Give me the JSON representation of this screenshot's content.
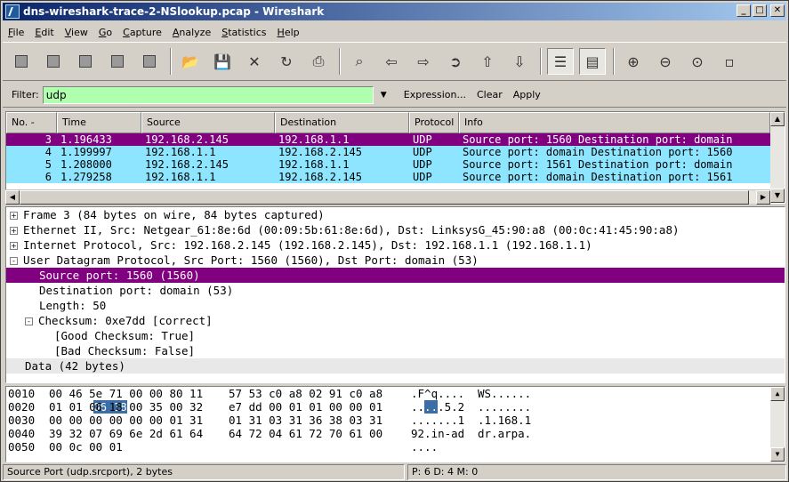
{
  "window": {
    "title": "dns-wireshark-trace-2-NSlookup.pcap - Wireshark"
  },
  "menu": [
    "File",
    "Edit",
    "View",
    "Go",
    "Capture",
    "Analyze",
    "Statistics",
    "Help"
  ],
  "toolbar": {
    "icons": [
      "interface-list-icon",
      "capture-options-icon",
      "start-capture-icon",
      "stop-capture-icon",
      "restart-capture-icon",
      "open-file-icon",
      "save-file-icon",
      "close-file-icon",
      "reload-icon",
      "print-icon",
      "find-packet-icon",
      "go-back-icon",
      "go-forward-icon",
      "go-to-packet-icon",
      "go-first-icon",
      "go-last-icon",
      "colorize-icon",
      "autoscroll-icon",
      "zoom-in-icon",
      "zoom-out-icon",
      "zoom-normal-icon",
      "resize-columns-icon"
    ]
  },
  "filter": {
    "label": "Filter:",
    "value": "udp",
    "expression": "Expression...",
    "clear": "Clear",
    "apply": "Apply"
  },
  "packet_list": {
    "columns": [
      "No. -",
      "Time",
      "Source",
      "Destination",
      "Protocol",
      "Info"
    ],
    "rows": [
      {
        "no": "3",
        "time": "1.196433",
        "src": "192.168.2.145",
        "dst": "192.168.1.1",
        "proto": "UDP",
        "info": "Source port: 1560  Destination port: domain"
      },
      {
        "no": "4",
        "time": "1.199997",
        "src": "192.168.1.1",
        "dst": "192.168.2.145",
        "proto": "UDP",
        "info": "Source port: domain  Destination port: 1560"
      },
      {
        "no": "5",
        "time": "1.208000",
        "src": "192.168.2.145",
        "dst": "192.168.1.1",
        "proto": "UDP",
        "info": "Source port: 1561  Destination port: domain"
      },
      {
        "no": "6",
        "time": "1.279258",
        "src": "192.168.1.1",
        "dst": "192.168.2.145",
        "proto": "UDP",
        "info": "Source port: domain  Destination port: 1561"
      }
    ]
  },
  "detail_tree": [
    {
      "text": "Frame 3 (84 bytes on wire, 84 bytes captured)",
      "exp": "+"
    },
    {
      "text": "Ethernet II, Src: Netgear_61:8e:6d (00:09:5b:61:8e:6d), Dst: LinksysG_45:90:a8 (00:0c:41:45:90:a8)",
      "exp": "+"
    },
    {
      "text": "Internet Protocol, Src: 192.168.2.145 (192.168.2.145), Dst: 192.168.1.1 (192.168.1.1)",
      "exp": "+"
    },
    {
      "text": "User Datagram Protocol, Src Port: 1560 (1560), Dst Port: domain (53)",
      "exp": "-"
    },
    {
      "text": "Source port: 1560 (1560)",
      "exp": ""
    },
    {
      "text": "Destination port: domain (53)",
      "exp": ""
    },
    {
      "text": "Length: 50",
      "exp": ""
    },
    {
      "text": "Checksum: 0xe7dd [correct]",
      "exp": "-"
    },
    {
      "text": "[Good Checksum: True]",
      "exp": ""
    },
    {
      "text": "[Bad Checksum: False]",
      "exp": ""
    },
    {
      "text": "Data (42 bytes)",
      "exp": ""
    }
  ],
  "hex_dump": [
    {
      "off": "0010",
      "hex1": "00 46 5e 71 00 00 80 11",
      "hex2": "57 53 c0 a8 02 91 c0 a8",
      "ascii1": ".F^q....",
      "ascii2": "WS......"
    },
    {
      "off": "0020",
      "hex1": "01 01 06 18 00 35 00 32",
      "hex2": "e7 dd 00 01 01 00 00 01",
      "ascii1": ".....5.2",
      "ascii2": "........"
    },
    {
      "off": "0030",
      "hex1": "00 00 00 00 00 00 01 31",
      "hex2": "01 31 03 31 36 38 03 31",
      "ascii1": ".......1",
      "ascii2": ".1.168.1"
    },
    {
      "off": "0040",
      "hex1": "39 32 07 69 6e 2d 61 64",
      "hex2": "64 72 04 61 72 70 61 00",
      "ascii1": "92.in-ad",
      "ascii2": "dr.arpa."
    },
    {
      "off": "0050",
      "hex1": "00 0c 00 01",
      "hex2": "",
      "ascii1": "....",
      "ascii2": ""
    }
  ],
  "hex_highlight": {
    "hex": "06 18",
    "ascii": ".."
  },
  "status": {
    "field": "Source Port (udp.srcport), 2 bytes",
    "counts": "P: 6 D: 4 M: 0"
  },
  "colors": {
    "selected": "#800080",
    "udp_row": "#8ee5ff",
    "filter_ok": "#afffaf"
  }
}
